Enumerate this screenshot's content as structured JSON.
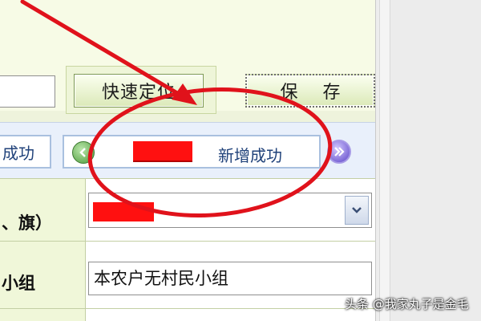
{
  "toolbar": {
    "locate_label": "快速定位",
    "save_label": "保 存"
  },
  "tabs": [
    {
      "label": "成功"
    },
    {
      "label": "新增成功"
    }
  ],
  "form": {
    "row1_label": "、旗）",
    "row2_label": "小组",
    "row2_value": "本农户无村民小组"
  },
  "icons": {
    "prev": "green-left-arrow-icon",
    "next": "purple-double-arrow-icon",
    "dropdown": "chevron-down-icon"
  },
  "colors": {
    "annotation_red": "#e0121b",
    "redaction": "#ff1010"
  },
  "watermark": "头条 @我家丸子是金毛"
}
